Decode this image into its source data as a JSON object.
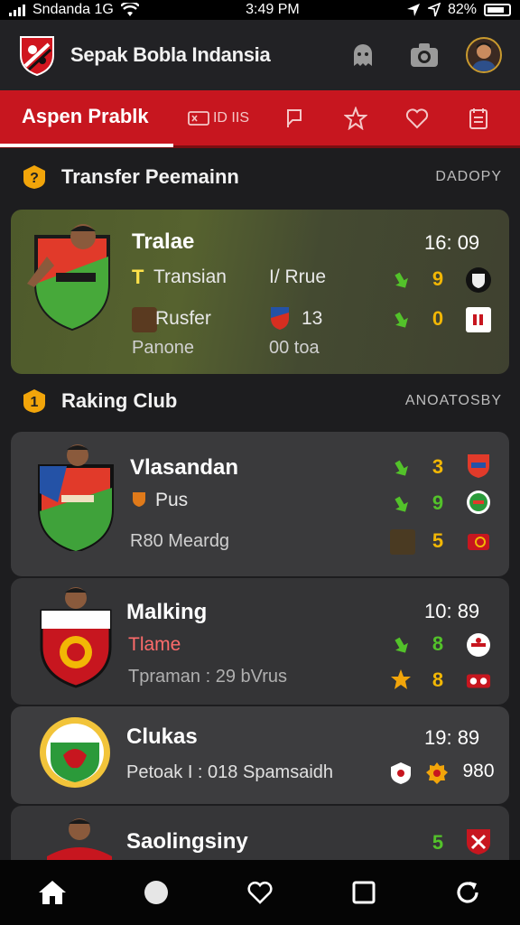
{
  "status": {
    "carrier": "Sndanda 1G",
    "time": "3:49 PM",
    "battery": "82%"
  },
  "header": {
    "title": "Sepak Bobla Indansia",
    "logo_icon": "shield-logo-icon"
  },
  "tabs": {
    "active_label": "Aspen Prablk",
    "second_label": "ID IIS"
  },
  "transfer_section": {
    "title": "Transfer Peemainn",
    "link": "DADOPY"
  },
  "featured": {
    "title": "Tralae",
    "time": "16: 09",
    "row1_label": "Transian",
    "row1_prefix": "T",
    "row1_mid": "I/ Rrue",
    "row1_value": "9",
    "row2_label": "Rusfer",
    "row2_mid": "13",
    "row2_value": "0",
    "footer_left": "Panone",
    "footer_mid": "00 toa"
  },
  "ranking_section": {
    "title": "Raking Club",
    "link": "ANOATOSBY"
  },
  "clubs": [
    {
      "name": "Vlasandan",
      "sub": "Pus",
      "footer": "R80 Meardg",
      "v1": "3",
      "v2": "9",
      "v3": "5"
    },
    {
      "name": "Malking",
      "sub": "Tlame",
      "time": "10: 89",
      "footer": "Tpraman : 29 bVrus",
      "v1": "8",
      "v2": "8"
    },
    {
      "name": "Clukas",
      "time": "19: 89",
      "footer": "Petoak I : 018 Spamsaidh",
      "value": "980"
    },
    {
      "name": "Saolingsiny",
      "v1": "5"
    }
  ],
  "colors": {
    "accent": "#c7161f",
    "gold": "#f2b705",
    "green": "#53c22a"
  }
}
